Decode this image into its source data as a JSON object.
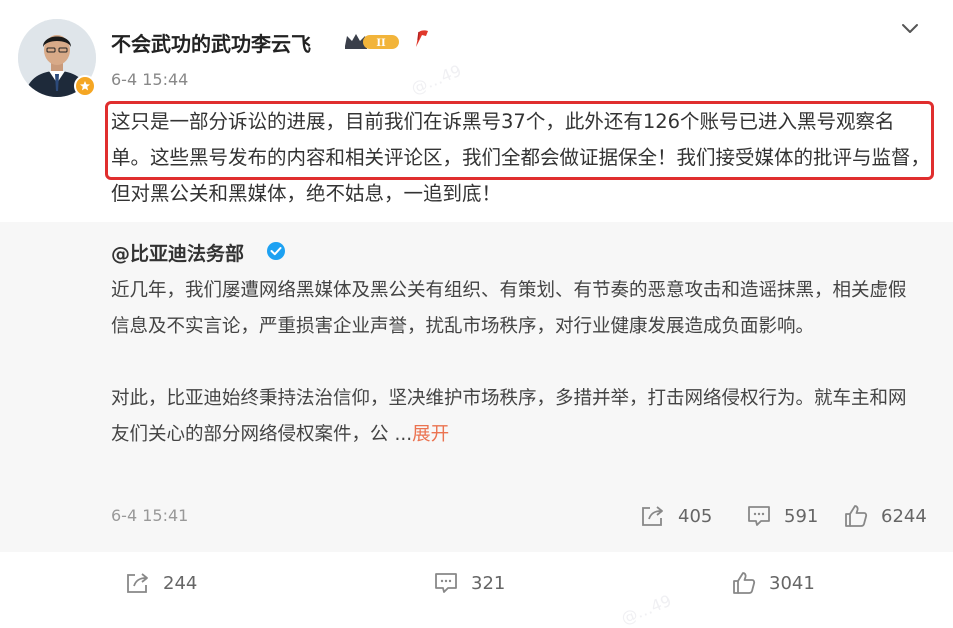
{
  "post": {
    "username": "不会武功的武功李云飞",
    "vip_level": "II",
    "time": "6-4 15:44",
    "text": "这只是一部分诉讼的进展，目前我们在诉黑号37个，此外还有126个账号已进入黑号观察名单。这些黑号发布的内容和相关评论区，我们全都会做证据保全！我们接受媒体的批评与监督，但对黑公关和黑媒体，绝不姑息，一追到底！"
  },
  "repost": {
    "author": "@比亚迪法务部",
    "paragraph1": "近几年，我们屡遭网络黑媒体及黑公关有组织、有策划、有节奏的恶意攻击和造谣抹黑，相关虚假信息及不实言论，严重损害企业声誉，扰乱市场秩序，对行业健康发展造成负面影响。",
    "paragraph2": "对此，比亚迪始终秉持法治信仰，坚决维护市场秩序，多措并举，打击网络侵权行为。就车主和网友们关心的部分网络侵权案件，公",
    "ellipsis": "...",
    "expand_label": "展开",
    "time": "6-4 15:41",
    "reposts": "405",
    "comments": "591",
    "likes": "6244"
  },
  "footer": {
    "reposts": "244",
    "comments": "321",
    "likes": "3041"
  },
  "colors": {
    "highlight": "#e02e2e",
    "link": "#eb7350",
    "verify_blue": "#1da1f2",
    "badge_orange": "#f5a623"
  },
  "icons": [
    "avatar",
    "verified-badge-icon",
    "vip-crown-icon",
    "fire-icon",
    "chevron-down-icon",
    "repost-icon",
    "comment-icon",
    "like-icon"
  ]
}
